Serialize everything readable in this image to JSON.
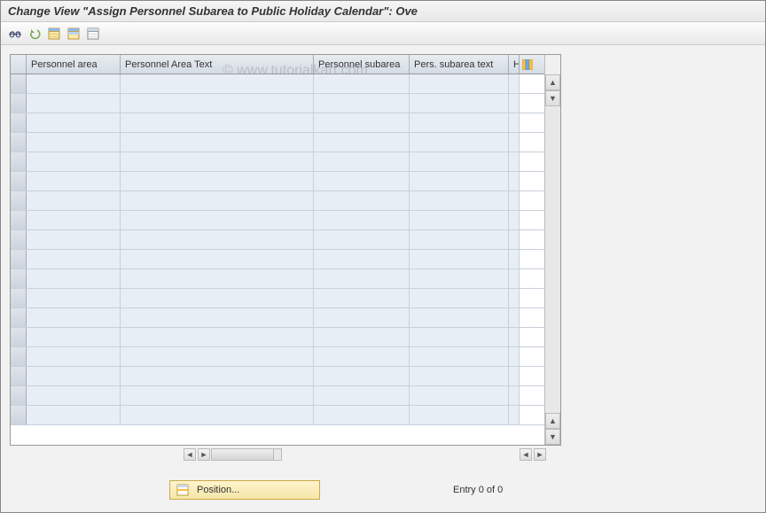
{
  "title": "Change View \"Assign Personnel Subarea to Public Holiday Calendar\": Ove",
  "watermark": "© www.tutorialkart.com",
  "toolbar": {
    "icons": [
      "other-view",
      "undo",
      "select-all",
      "select-block",
      "deselect-all"
    ]
  },
  "table": {
    "columns": {
      "personnel_area": "Personnel area",
      "personnel_area_text": "Personnel Area Text",
      "personnel_subarea": "Personnel subarea",
      "pers_subarea_text": "Pers. subarea text",
      "h": "H"
    },
    "row_count": 18
  },
  "footer": {
    "position_label": "Position...",
    "entry_text": "Entry 0 of 0"
  }
}
